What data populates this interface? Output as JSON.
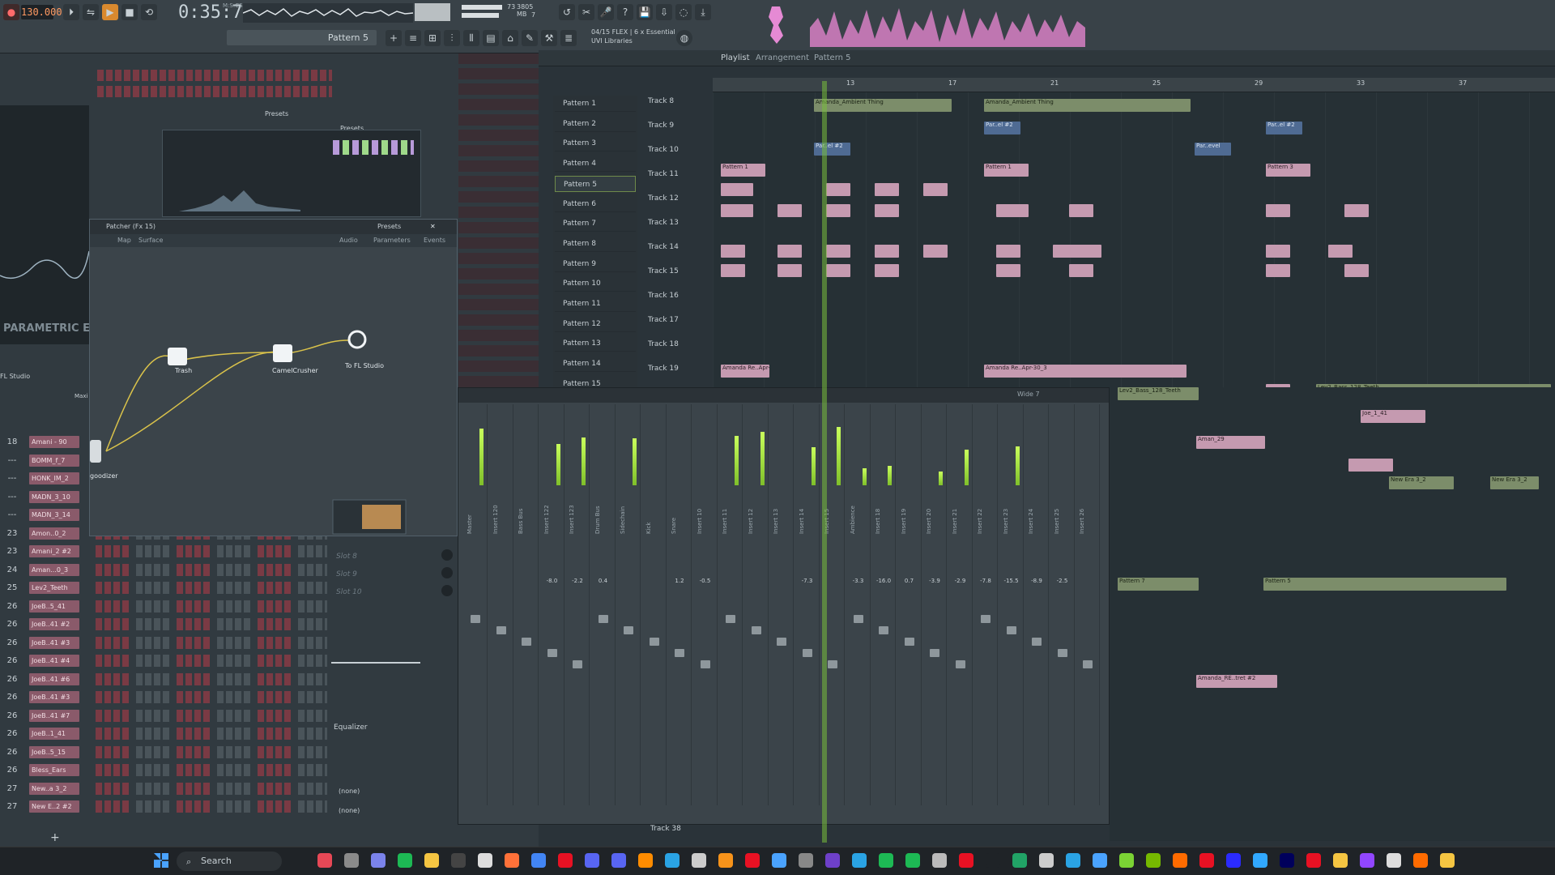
{
  "toolbar": {
    "tempo": "130.000",
    "time": "0:35:78",
    "time_unit": "M:S:CS",
    "cpu": "73",
    "memory": "3805 MB",
    "voices": "7",
    "pattern": "Pattern 5",
    "plugin_info_line1": "04/15 FLEX | 6 x Essential",
    "plugin_info_line2": "UVI Libraries",
    "accent": "#ff9a62",
    "waveform_color": "#e58ad4"
  },
  "channel_rack": {
    "rows": [
      {
        "num": "18",
        "name": "Amani - 90"
      },
      {
        "num": "---",
        "name": "BOMM_f_7"
      },
      {
        "num": "---",
        "name": "HONK_IM_2"
      },
      {
        "num": "---",
        "name": "MADN_3_10"
      },
      {
        "num": "---",
        "name": "MADN_3_14"
      },
      {
        "num": "23",
        "name": "Amon..0_2"
      },
      {
        "num": "23",
        "name": "Amani_2 #2"
      },
      {
        "num": "24",
        "name": "Aman...0_3"
      },
      {
        "num": "25",
        "name": "Lev2_Teeth"
      },
      {
        "num": "26",
        "name": "JoeB..5_41"
      },
      {
        "num": "26",
        "name": "JoeB..41 #2"
      },
      {
        "num": "26",
        "name": "JoeB..41 #3"
      },
      {
        "num": "26",
        "name": "JoeB..41 #4"
      },
      {
        "num": "26",
        "name": "JoeB..41 #6"
      },
      {
        "num": "26",
        "name": "JoeB..41 #3"
      },
      {
        "num": "26",
        "name": "JoeB..41 #7"
      },
      {
        "num": "26",
        "name": "JoeB..1_41"
      },
      {
        "num": "26",
        "name": "JoeB..5_15"
      },
      {
        "num": "26",
        "name": "Bless_Ears"
      },
      {
        "num": "27",
        "name": "New..a 3_2"
      },
      {
        "num": "27",
        "name": "New E..2 #2"
      }
    ]
  },
  "eq": {
    "label": "PARAMETRIC EQ",
    "studio": "FL Studio",
    "maxi": "Maxi"
  },
  "preset_bars": {
    "presets_1": "Presets",
    "presets_2": "Presets"
  },
  "patcher": {
    "title": "Patcher (Fx 15)",
    "tab_map": "Map",
    "tab_surface": "Surface",
    "presets": "Presets",
    "legend_audio": "Audio",
    "legend_params": "Parameters",
    "legend_events": "Events",
    "nodes": {
      "from": "goodizer",
      "trash": "Trash",
      "camel": "CamelCrusher",
      "to": "To FL Studio"
    }
  },
  "playlist": {
    "title": "Playlist",
    "breadcrumb_arrangement": "Arrangement",
    "breadcrumb_pattern": "Pattern 5",
    "patterns": [
      "Pattern 1",
      "Pattern 2",
      "Pattern 3",
      "Pattern 4",
      "Pattern 5",
      "Pattern 6",
      "Pattern 7",
      "Pattern 8",
      "Pattern 9",
      "Pattern 10",
      "Pattern 11",
      "Pattern 12",
      "Pattern 13",
      "Pattern 14",
      "Pattern 15"
    ],
    "selected_pattern": "Pattern 5",
    "tracks": [
      "Track 8",
      "Track 9",
      "Track 10",
      "Track 11",
      "Track 12",
      "Track 13",
      "Track 14",
      "Track 15",
      "Track 16",
      "Track 17",
      "Track 18",
      "Track 19"
    ],
    "timeline": [
      "13",
      "17",
      "21",
      "25",
      "29",
      "33",
      "37"
    ],
    "clips": {
      "ambient1": "Amanda_Ambient Thing",
      "ambient2": "Amanda_Ambient Thing",
      "par1": "Par..el #2",
      "par2": "Par..el #2",
      "par3": "Par..el #2",
      "par4": "Par..evel",
      "pat1": "Pattern 1",
      "pat3": "Pattern 3",
      "amanda_ap": "Amanda Re..Apr-30_3",
      "bass": "Lev2_Bass_128_Teeth",
      "new": "New Era 3_2",
      "pattern7": "Pattern 7",
      "pattern5": "Pattern 5",
      "amanda_re": "Amanda_RE..tret #2",
      "joe": "Joe_1_41",
      "aman": "Aman_29"
    },
    "track38": "Track 38"
  },
  "mixer": {
    "wide_label": "Wide 7",
    "channels": [
      {
        "name": "Master",
        "db": "",
        "level": 0.82
      },
      {
        "name": "Insert 120",
        "db": "",
        "level": 0.0
      },
      {
        "name": "Bass Bus",
        "db": "",
        "level": 0.0
      },
      {
        "name": "Insert 122",
        "db": "-8.0",
        "level": 0.6
      },
      {
        "name": "Insert 123",
        "db": "-2.2",
        "level": 0.7
      },
      {
        "name": "Drum Bus",
        "db": "0.4",
        "level": 0.0
      },
      {
        "name": "Sidechain",
        "db": "",
        "level": 0.68
      },
      {
        "name": "Kick",
        "db": "",
        "level": 0.0
      },
      {
        "name": "Snare",
        "db": "1.2",
        "level": 0.0
      },
      {
        "name": "Insert 10",
        "db": "-0.5",
        "level": 0.0
      },
      {
        "name": "Insert 11",
        "db": "",
        "level": 0.72
      },
      {
        "name": "Insert 12",
        "db": "",
        "level": 0.78
      },
      {
        "name": "Insert 13",
        "db": "",
        "level": 0.0
      },
      {
        "name": "Insert 14",
        "db": "-7.3",
        "level": 0.55
      },
      {
        "name": "Insert 15",
        "db": "",
        "level": 0.85
      },
      {
        "name": "Ambience",
        "db": "-3.3",
        "level": 0.25
      },
      {
        "name": "Insert 18",
        "db": "-16.0",
        "level": 0.28
      },
      {
        "name": "Insert 19",
        "db": "0.7",
        "level": 0.0
      },
      {
        "name": "Insert 20",
        "db": "-3.9",
        "level": 0.2
      },
      {
        "name": "Insert 21",
        "db": "-2.9",
        "level": 0.52
      },
      {
        "name": "Insert 22",
        "db": "-7.8",
        "level": 0.0
      },
      {
        "name": "Insert 23",
        "db": "-15.5",
        "level": 0.56
      },
      {
        "name": "Insert 24",
        "db": "-8.9",
        "level": 0.0
      },
      {
        "name": "Insert 25",
        "db": "-2.5",
        "level": 0.0
      },
      {
        "name": "Insert 26",
        "db": "",
        "level": 0.0
      }
    ],
    "slots": [
      "Slot 8",
      "Slot 9",
      "Slot 10"
    ],
    "equalizer": "Equalizer",
    "none1": "(none)",
    "none2": "(none)"
  },
  "taskbar": {
    "search": "Search"
  }
}
